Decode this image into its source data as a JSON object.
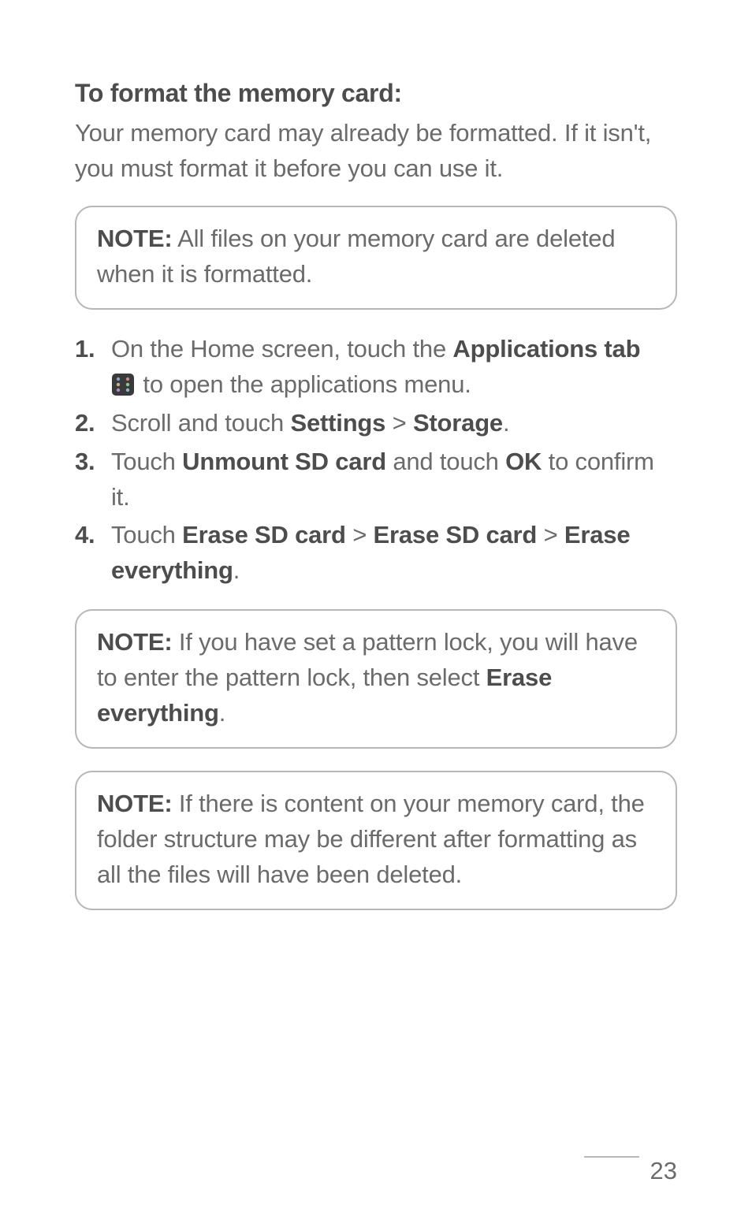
{
  "heading": "To format the memory card:",
  "intro": "Your memory card may already be formatted. If it isn't, you must format it before you can use it.",
  "note1": {
    "label": "NOTE:",
    "text": " All files on your memory card are deleted when it is formatted."
  },
  "steps": {
    "s1a": "On the Home screen, touch the ",
    "s1b": "Applications tab",
    "s1c": " to open the applications menu.",
    "s2a": "Scroll and touch ",
    "s2b": "Settings",
    "s2gt1": " > ",
    "s2c": "Storage",
    "s2d": ".",
    "s3a": "Touch ",
    "s3b": "Unmount SD card",
    "s3c": " and touch ",
    "s3d": "OK",
    "s3e": " to confirm it.",
    "s4a": "Touch ",
    "s4b": "Erase SD card",
    "s4gt1": " > ",
    "s4c": "Erase SD card",
    "s4gt2": " > ",
    "s4d": "Erase everything",
    "s4e": "."
  },
  "note2": {
    "label": "NOTE:",
    "t1": " If you have set a pattern lock, you will have to enter the pattern lock, then select ",
    "t2": "Erase everything",
    "t3": "."
  },
  "note3": {
    "label": "NOTE:",
    "text": " If there is content on your memory card, the folder structure may be different after formatting as all the files will have been deleted."
  },
  "pageNumber": "23"
}
